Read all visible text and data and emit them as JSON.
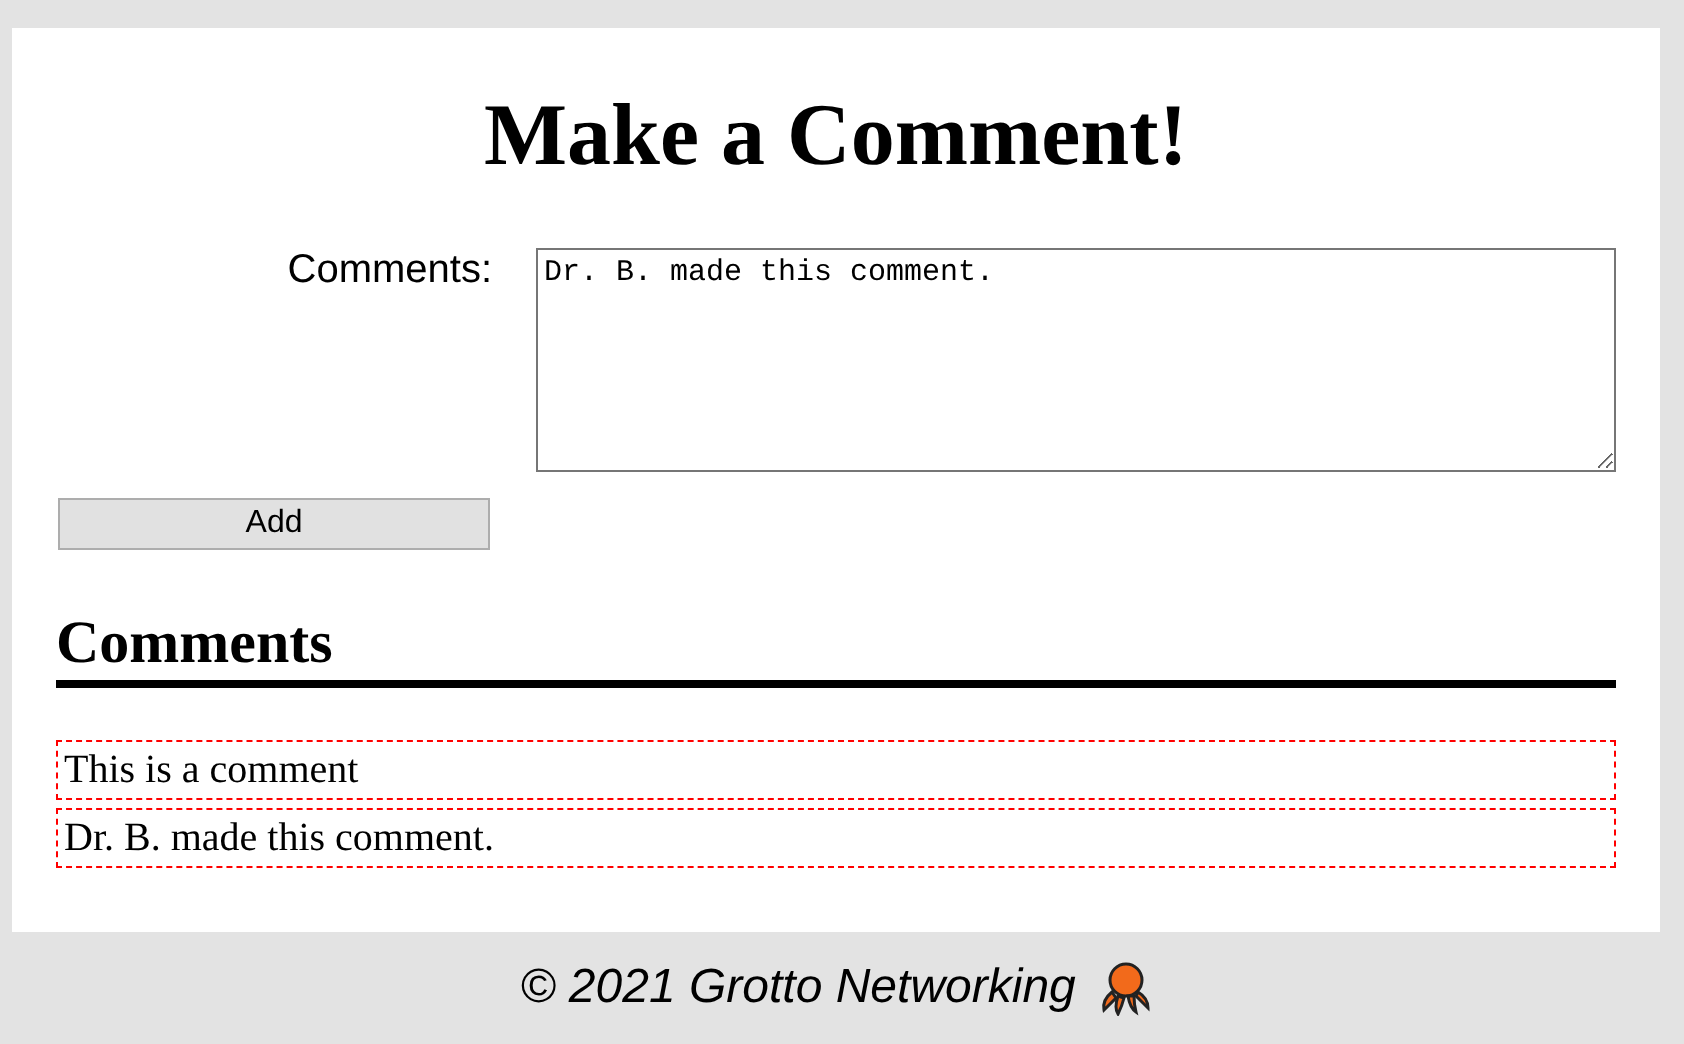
{
  "title": "Make a Comment!",
  "form": {
    "label": "Comments:",
    "value": "Dr. B. made this comment.",
    "button": "Add"
  },
  "comments_heading": "Comments",
  "comments": [
    "This is a comment",
    "Dr. B. made this comment."
  ],
  "footer": "© 2021 Grotto Networking"
}
